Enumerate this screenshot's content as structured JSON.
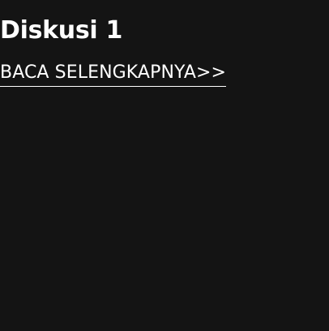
{
  "card": {
    "title": "Diskusi 1",
    "read_more_label": "BACA SELENGKAPNYA>>"
  },
  "colors": {
    "background": "#141414",
    "text": "#ffffff"
  }
}
